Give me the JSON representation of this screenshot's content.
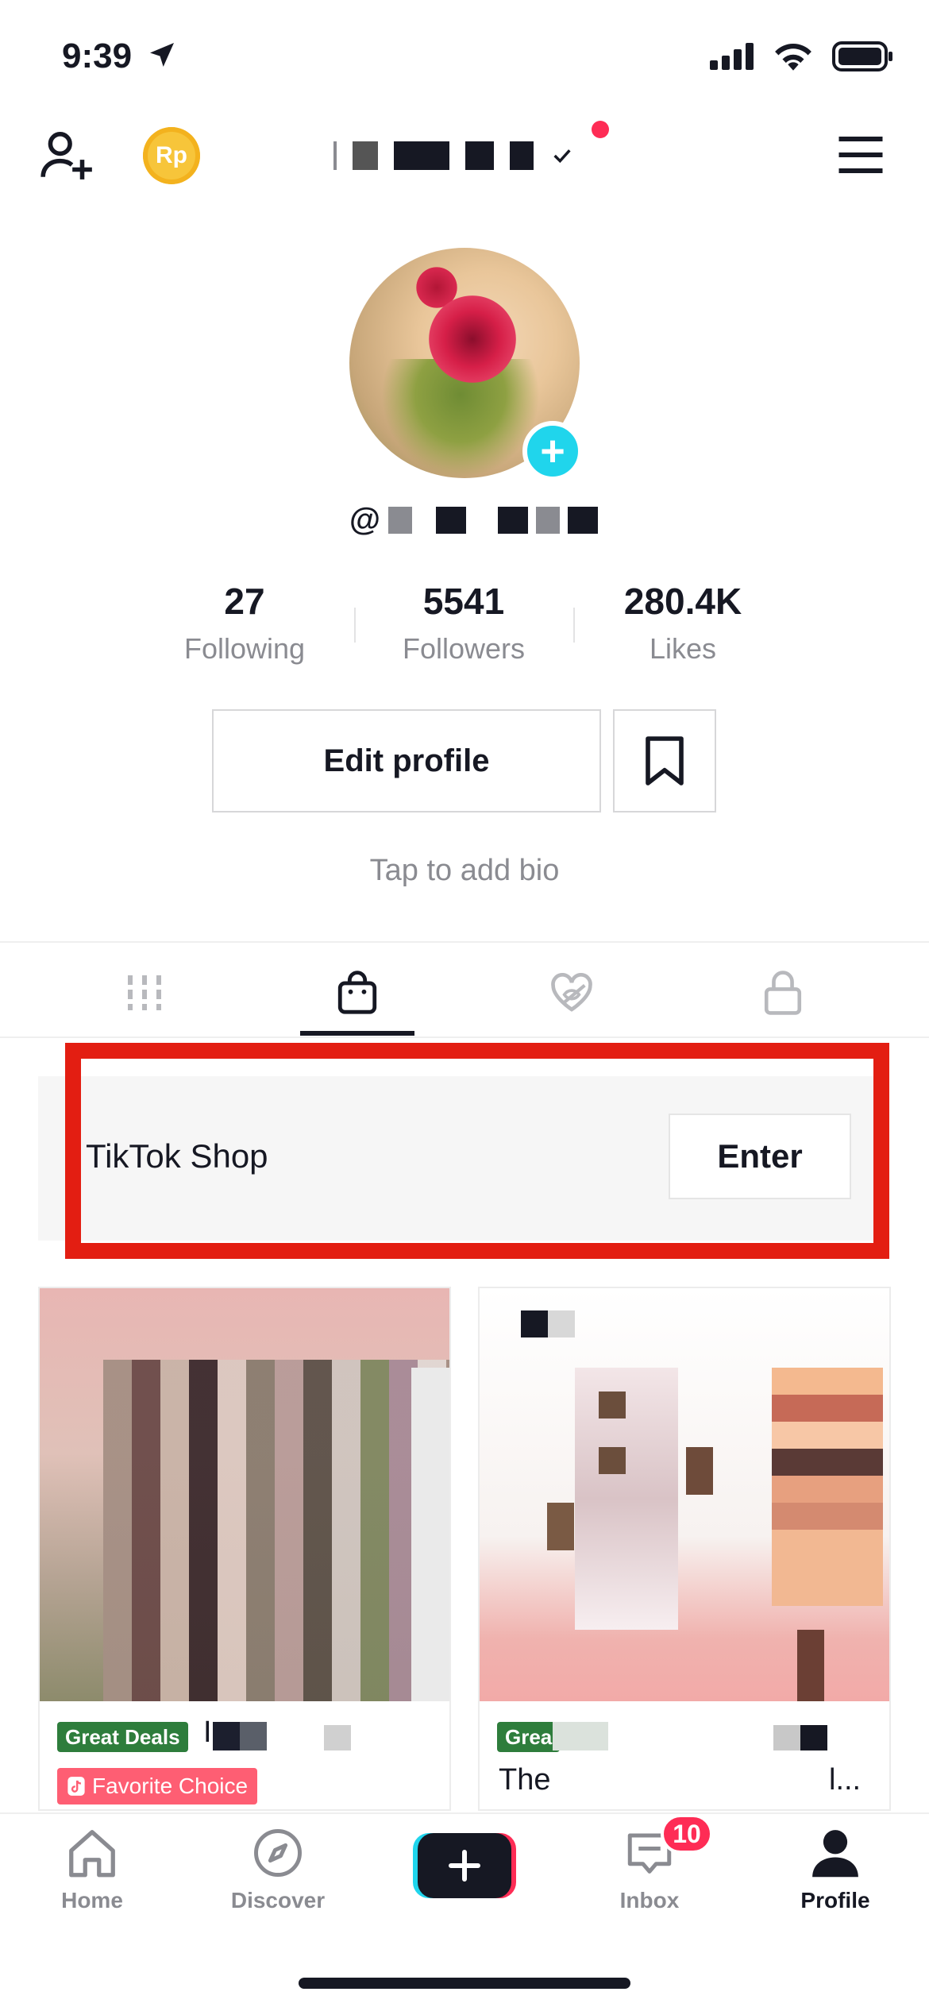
{
  "status_bar": {
    "time": "9:39"
  },
  "header": {
    "coin_label": "Rp"
  },
  "profile": {
    "handle_prefix": "@"
  },
  "stats": [
    {
      "value": "27",
      "label": "Following"
    },
    {
      "value": "5541",
      "label": "Followers"
    },
    {
      "value": "280.4K",
      "label": "Likes"
    }
  ],
  "actions": {
    "edit_profile": "Edit profile",
    "bio_hint": "Tap to add bio"
  },
  "tabs": [
    "videos-grid-icon",
    "shop-bag-icon",
    "liked-hidden-icon",
    "private-lock-icon"
  ],
  "shop": {
    "title": "TikTok Shop",
    "enter_label": "Enter"
  },
  "products": [
    {
      "deal_tag": "Great Deals",
      "fav_tag": "Favorite Choice",
      "title_visible": "I"
    },
    {
      "deal_tag": "Grea",
      "title_start": "The",
      "title_end": "l..."
    }
  ],
  "nav": {
    "home": "Home",
    "discover": "Discover",
    "inbox": "Inbox",
    "profile": "Profile",
    "inbox_badge": "10"
  },
  "colors": {
    "accent": "#fe2c55",
    "cyan": "#20d5ec",
    "highlight": "#e31e12",
    "deal_green": "#2e7d3c"
  }
}
